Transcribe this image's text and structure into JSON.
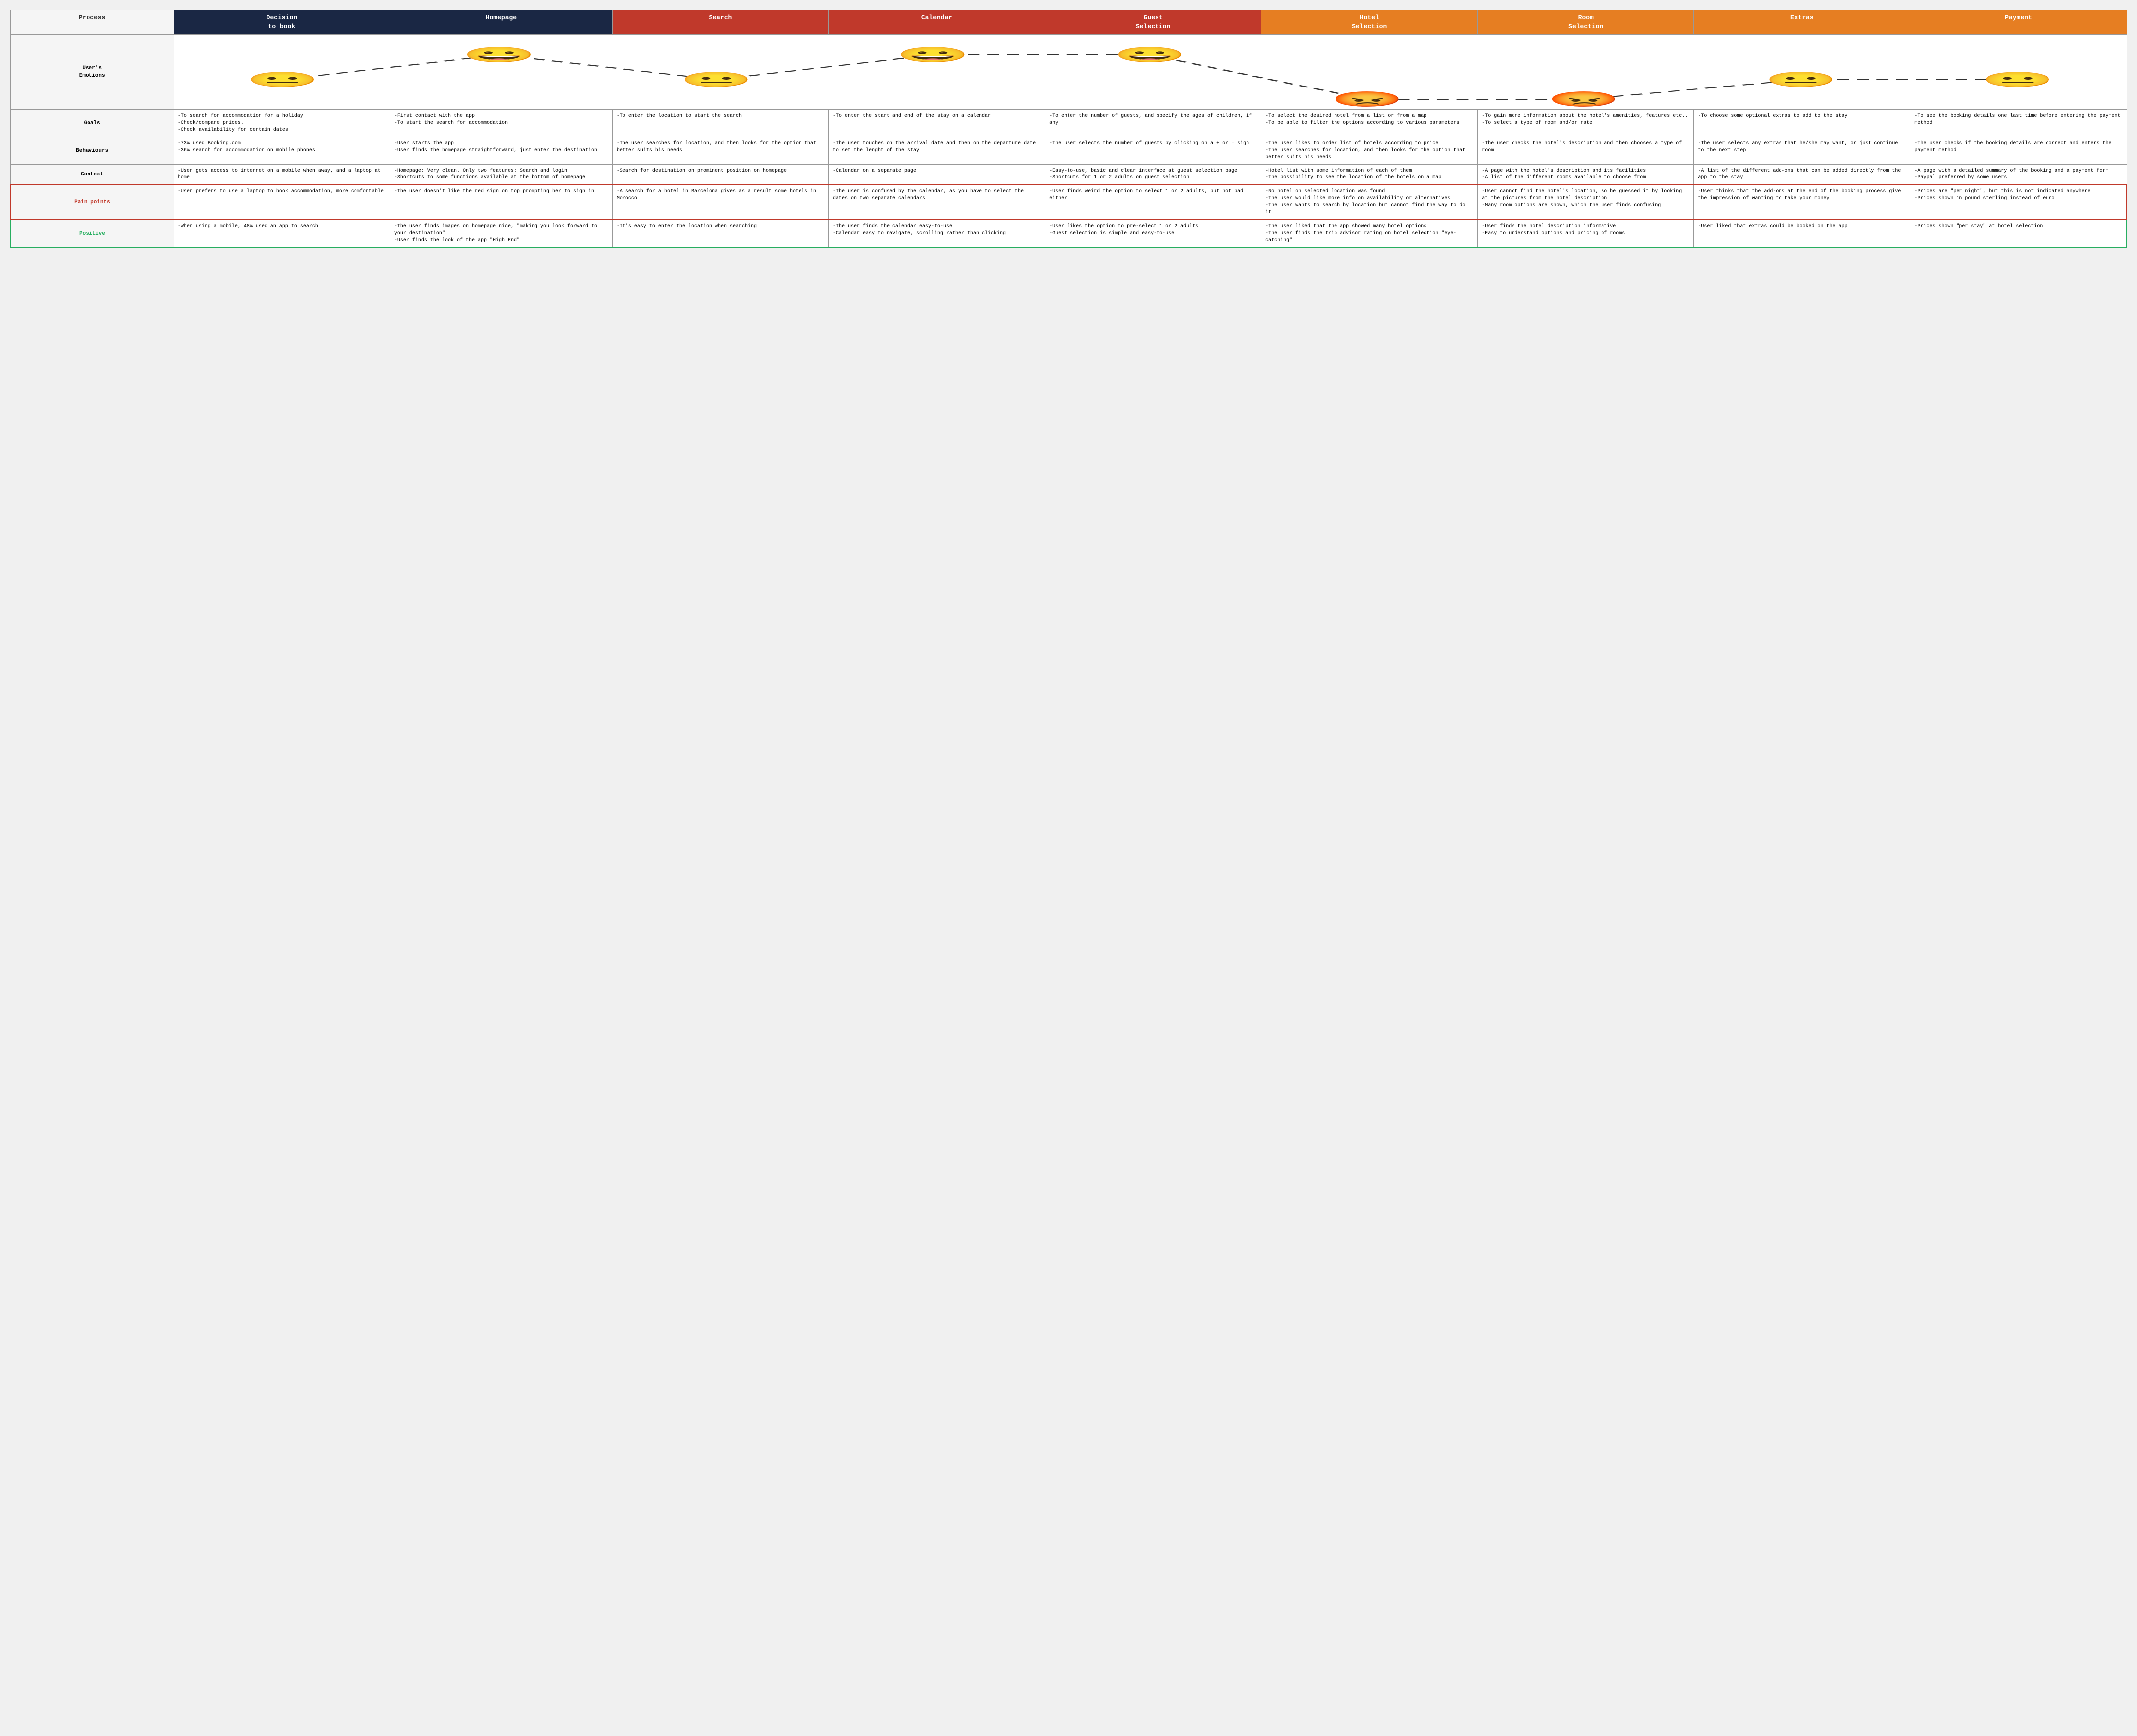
{
  "header": {
    "columns": [
      {
        "label": "Process",
        "class": "col-process"
      },
      {
        "label": "Decision\nto book",
        "class": "col-decision"
      },
      {
        "label": "Homepage",
        "class": "col-homepage"
      },
      {
        "label": "Search",
        "class": "col-search"
      },
      {
        "label": "Calendar",
        "class": "col-calendar"
      },
      {
        "label": "Guest\nSelection",
        "class": "col-guest"
      },
      {
        "label": "Hotel\nSelection",
        "class": "col-hotel"
      },
      {
        "label": "Room\nSelection",
        "class": "col-room"
      },
      {
        "label": "Extras",
        "class": "col-extras"
      },
      {
        "label": "Payment",
        "class": "col-payment"
      }
    ]
  },
  "emotions": {
    "label": "User's\nEmotions",
    "values": [
      {
        "emoji": "😐",
        "level": 3
      },
      {
        "emoji": "😀",
        "level": 5
      },
      {
        "emoji": "😐",
        "level": 3
      },
      {
        "emoji": "😀",
        "level": 5
      },
      {
        "emoji": "😀",
        "level": 5
      },
      {
        "emoji": "😡",
        "level": 1
      },
      {
        "emoji": "😡",
        "level": 1
      },
      {
        "emoji": "😐",
        "level": 3
      },
      {
        "emoji": "😐",
        "level": 3
      }
    ]
  },
  "rows": [
    {
      "label": "Goals",
      "label_class": "",
      "cells": [
        "-To search for accommodation for a holiday\n-Check/compare prices.\n-Check availability for certain dates",
        "-First contact with the app\n-To start the search for accommodation",
        "-To enter the location to start the search",
        "-To enter the start and end of the stay on a calendar",
        "-To enter the number of guests, and specify the ages of children, if any",
        "-To select the desired hotel from a list or from a map\n-To be able to filter the options according to various parameters",
        "-To gain more information about the hotel's amenities, features etc..\n-To select a type of room and/or rate",
        "-To choose some optional extras to add to the stay",
        "-To see the booking details one last time before entering the payment method"
      ]
    },
    {
      "label": "Behaviours",
      "label_class": "",
      "cells": [
        "-73% used Booking.com\n-36% search for accommodation on mobile phones",
        "-User starts the app\n-User finds the homepage straightforward, just enter the destination",
        "-The user searches for location, and then looks for the option that better suits his needs",
        "-The user touches on the arrival date and then on the departure date to set the lenght of the stay",
        "-The user selects the number of guests by clicking on a + or - sign",
        "-The user likes to order list of hotels according to price\n-The user searches for location, and then looks for the option that better suits his needs",
        "-The user checks the hotel's description and then chooses a type of room",
        "-The user selects any extras that he/she may want, or just continue to the next step",
        "-The user checks if the booking details are correct and enters the payment method"
      ]
    },
    {
      "label": "Context",
      "label_class": "",
      "cells": [
        "-User gets access to internet on a mobile when away, and a laptop at home",
        "-Homepage: Very clean. Only two features: Search and login\n-Shortcuts to some functions available at the bottom of homepage",
        "-Search for destination on prominent position on homepage",
        "-Calendar on a separate page",
        "-Easy-to-use, basic and clear interface at guest selection page\n-Shortcuts for 1 or 2 adults on guest selection",
        "-Hotel list with some information of each of them\n-The possibility to see the location of the hotels on a map",
        "-A page with the hotel's description and its facilities\n-A list of the different rooms available to choose from",
        "-A list of the different add-ons that can be added directly from the app to the stay",
        "-A page with a detailed summary of the booking and a payment form\n-Paypal preferred by some users"
      ]
    },
    {
      "label": "Pain points",
      "label_class": "pain",
      "cells": [
        "-User prefers to use a laptop to book accommodation, more comfortable",
        "-The user doesn't like the red sign on top prompting her to sign in",
        "-A search for a hotel in Barcelona gives as a result some hotels in Morocco",
        "-The user is confused by the calendar, as you have to select the dates on two separate calendars",
        "-User finds weird the option to select 1 or 2 adults, but not bad either",
        "-No hotel on selected location was found\n-The user would like more info on availability or alternatives\n-The user wants to search by location but cannot find the way to do it",
        "-User cannot find the hotel's location, so he guessed it by looking at the pictures from the hotel description\n-Many room options are shown, which the user finds confusing",
        "-User thinks that the add-ons at the end of the booking process give the impression of wanting to take your money",
        "-Prices are \"per night\", but this is not indicated anywhere\n-Prices shown in pound sterling instead of euro"
      ]
    },
    {
      "label": "Positive",
      "label_class": "positive",
      "cells": [
        "-When using a mobile, 48% used an app to search",
        "-The user finds images on homepage nice, \"making you look forward to your destination\"\n-User finds the look of the app \"High End\"",
        "-It's easy to enter the location when searching",
        "-The user finds the calendar easy-to-use\n-Calendar easy to navigate, scrolling rather than clicking",
        "-User likes the option to pre-select 1 or 2 adults\n-Guest selection is simple and easy-to-use",
        "-The user liked that the app showed many hotel options\n-The user finds the trip advisor rating on hotel selection \"eye-catching\"",
        "-User finds the hotel description informative\n-Easy to understand options and pricing of rooms",
        "-User liked that extras could be booked on the app",
        "-Prices shown \"per stay\" at hotel selection"
      ]
    }
  ]
}
